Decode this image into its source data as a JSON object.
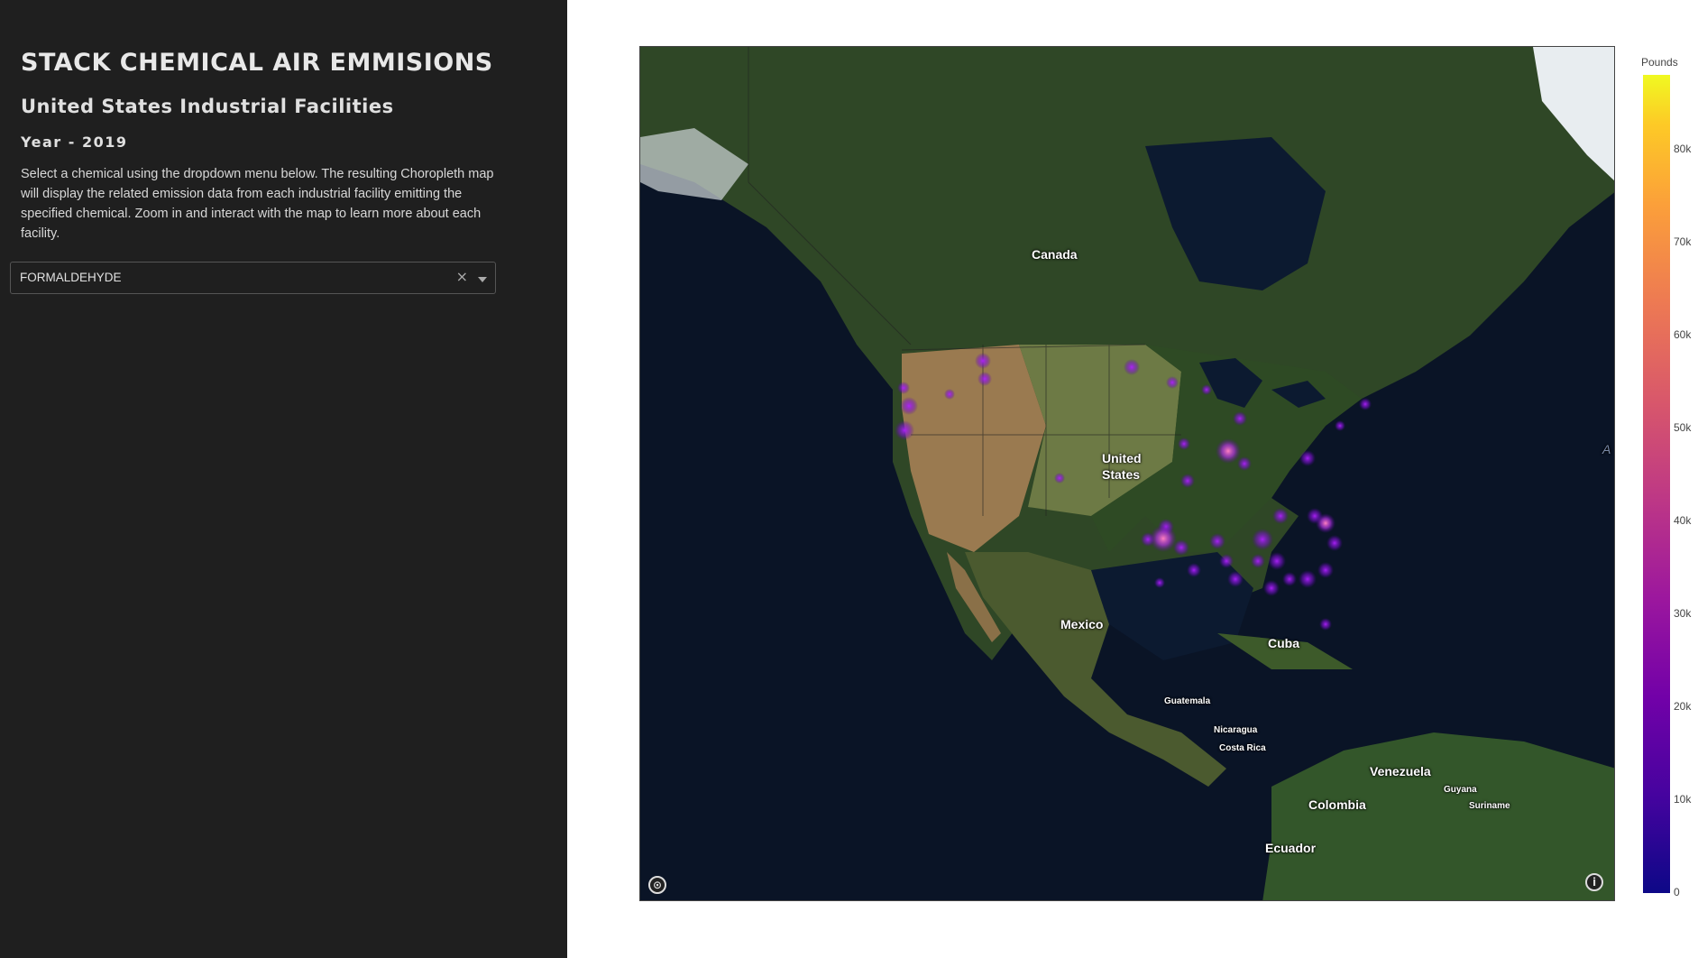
{
  "sidebar": {
    "title": "STACK CHEMICAL AIR EMMISIONS",
    "subtitle": "United States Industrial Facilities",
    "year": "Year - 2019",
    "description": "Select a chemical using the dropdown menu below. The resulting Choropleth map will display the related emission data from each industrial facility emitting the specified chemical. Zoom in and interact with the map to learn more about each facility.",
    "dropdown": {
      "value": "FORMALDEHYDE",
      "clear": "×"
    }
  },
  "map": {
    "labels": {
      "canada": "Canada",
      "united_states_1": "United",
      "united_states_2": "States",
      "mexico": "Mexico",
      "cuba": "Cuba",
      "guatemala": "Guatemala",
      "nicaragua": "Nicaragua",
      "costa_rica": "Costa Rica",
      "venezuela": "Venezuela",
      "guyana": "Guyana",
      "suriname": "Suriname",
      "colombia": "Colombia",
      "ecuador": "Ecuador",
      "edge_letter": "A"
    },
    "compass_icon": "compass-icon",
    "info_icon": "info-icon",
    "info_symbol": "i"
  },
  "colorbar": {
    "title": "Pounds",
    "ticks": [
      "80k",
      "70k",
      "60k",
      "50k",
      "40k",
      "30k",
      "20k",
      "10k",
      "0"
    ],
    "colorscale": [
      "#0d0887",
      "#7201a8",
      "#bd3786",
      "#ed7953",
      "#f0f921"
    ]
  }
}
